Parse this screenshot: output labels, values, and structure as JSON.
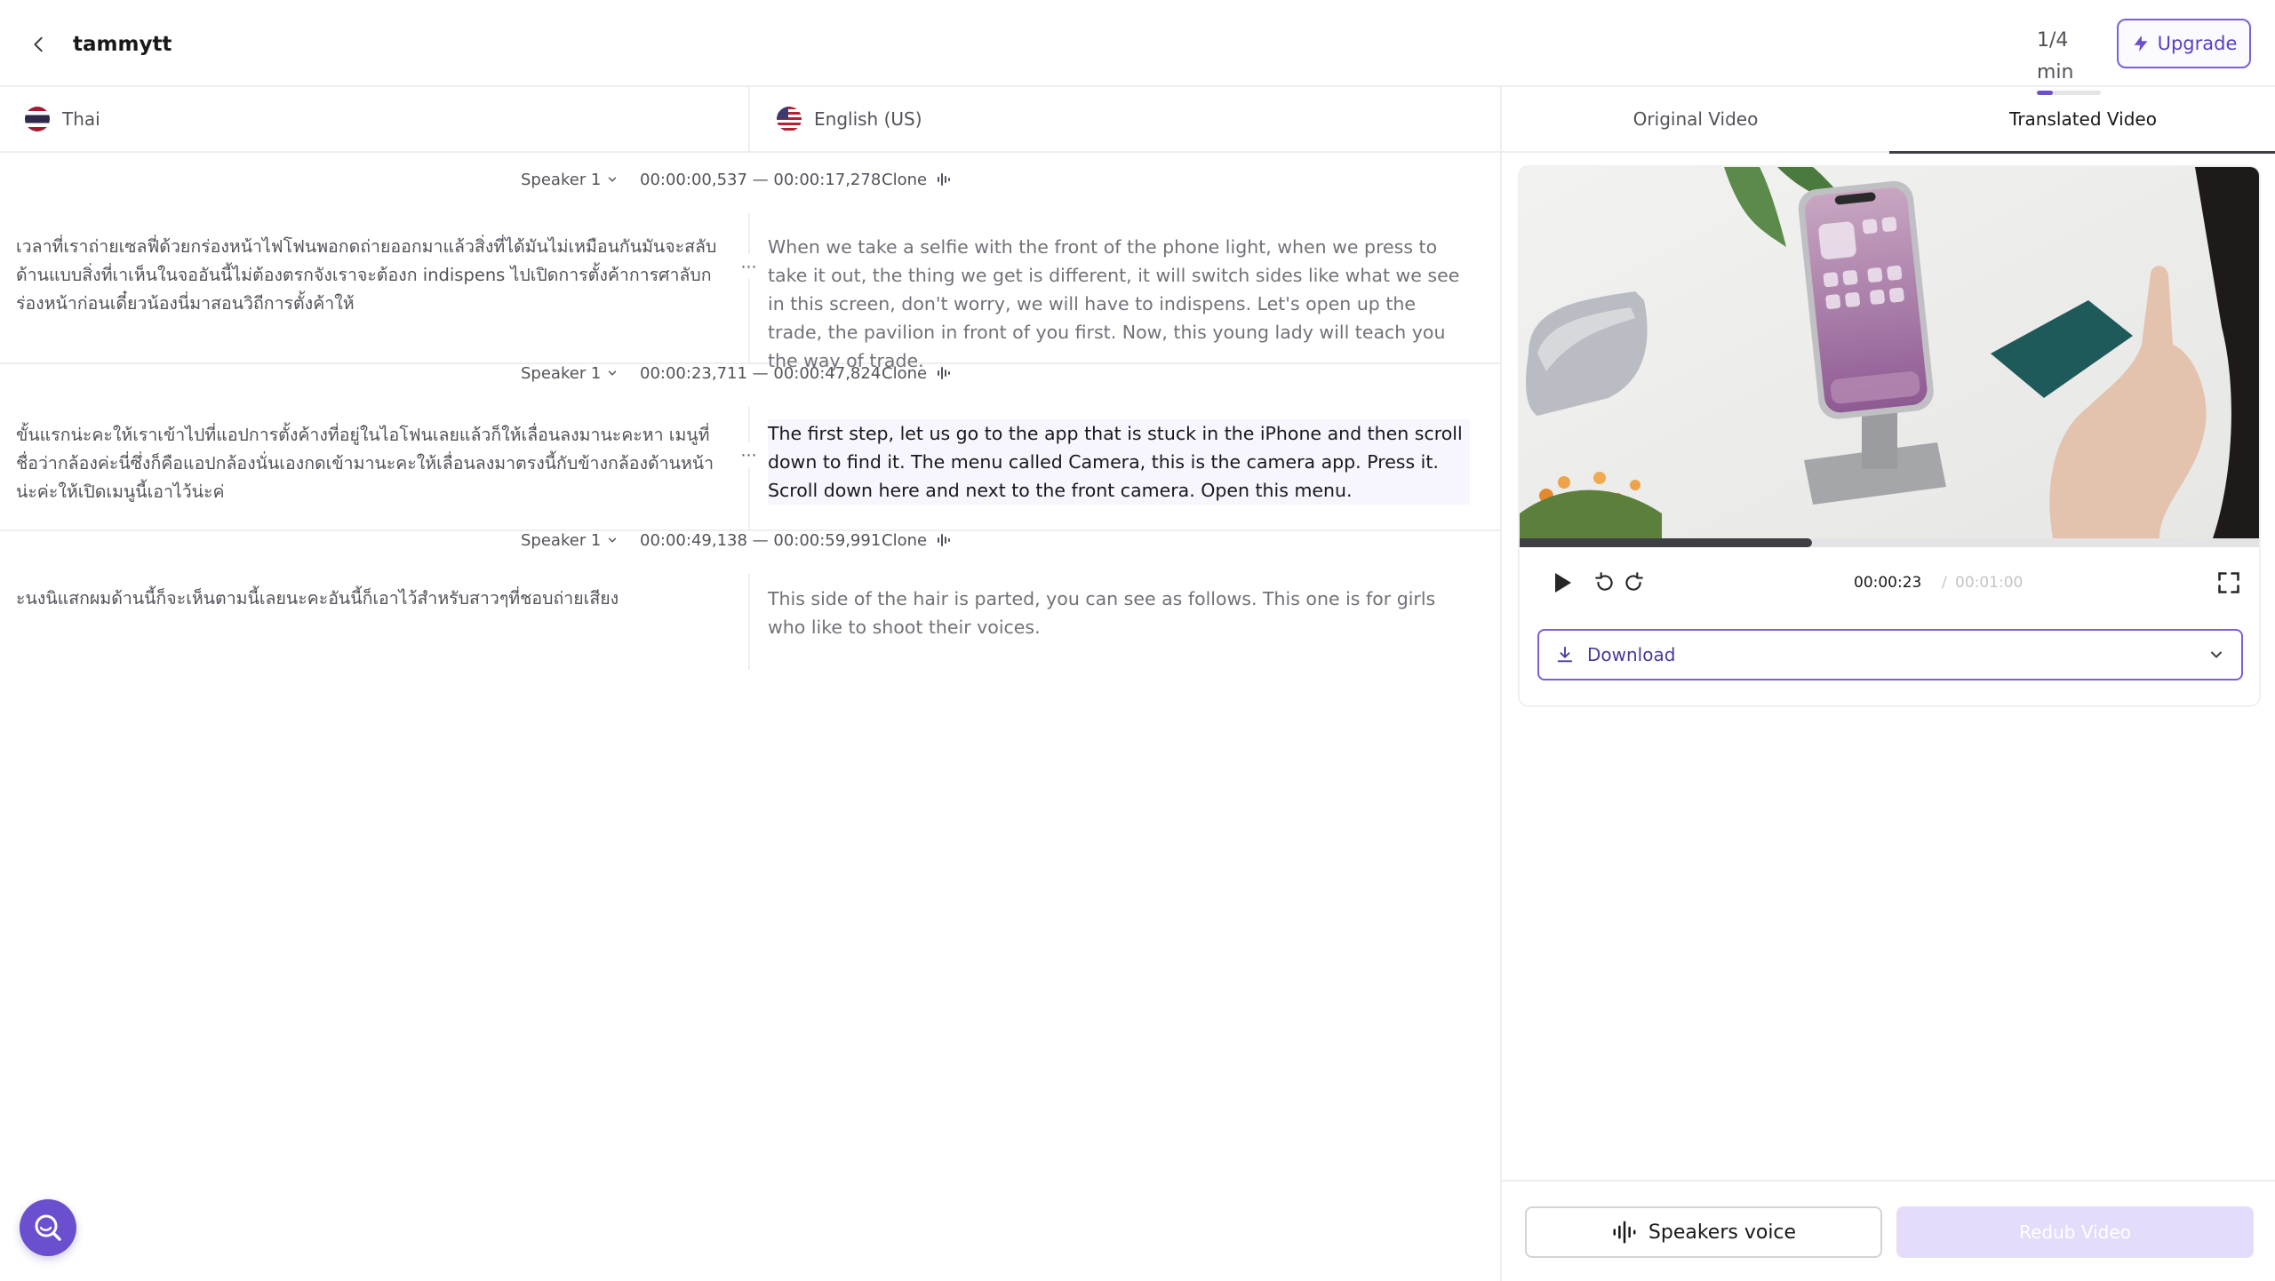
{
  "header": {
    "project_title": "tammytt",
    "usage_text": "1/4 min",
    "usage_fraction": 0.25,
    "upgrade_label": "Upgrade"
  },
  "languages": {
    "source": {
      "label": "Thai",
      "flag": "thailand-flag"
    },
    "target": {
      "label": "English (US)",
      "flag": "us-flag"
    }
  },
  "segments": [
    {
      "speaker": "Speaker 1",
      "time_range": "00:00:00,537 — 00:00:17,278",
      "clone_label": "Clone",
      "source_text": "เวลาที่เราถ่ายเซลฟี่ด้วยกร่องหน้าไฟโฟนพอกดถ่ายออกมาแล้วสิ่งที่ได้มันไม่เหมือนกันมันจะสลับด้านแบบสิ่งที่เาเห็นในจออันนี้ไม่ต้องตรกจังเราจะต้องก indispens ไปเปิดการตั้งค้าการศาลับกร่องหน้าก่อนเดี๋ยวน้องนี่มาสอนวิถีการตั้งค้าให้",
      "target_text": "When we take a selfie with the front of the phone light, when we press to take it out, the thing we get is different, it will switch sides like what we see in this screen, don't worry, we will have to indispens. Let's open up the trade, the pavilion in front of you first. Now, this young lady will teach you the way of trade.",
      "active": false
    },
    {
      "speaker": "Speaker 1",
      "time_range": "00:00:23,711 — 00:00:47,824",
      "clone_label": "Clone",
      "source_text": "ขั้นแรกน่ะคะให้เราเข้าไปที่แอปการตั้งค้างที่อยู่ในไอโฟนเลยแล้วก็ให้เลื่อนลงมานะคะหา เมนูที่ชื่อว่ากล้องค่ะนี่ซึ่งก็คือแอปกล้องนั่นเองกดเข้ามานะคะให้เลื่อนลงมาตรงนี้กับข้างกล้องด้านหน้าน่ะค่ะให้เปิดเมนูนี้เอาไว้น่ะค่",
      "target_text": "The first step, let us go to the app that is stuck in the iPhone and then scroll down to find it. The menu called Camera, this is the camera app. Press it. Scroll down here and next to the front camera. Open this menu.",
      "active": true
    },
    {
      "speaker": "Speaker 1",
      "time_range": "00:00:49,138 — 00:00:59,991",
      "clone_label": "Clone",
      "source_text": "ะนงนิแสกผมด้านนี้ก็จะเห็นตามนี้เลยนะคะอันนี้ก็เอาไว้สำหรับสาวๆที่ชอบถ่ายเสียง",
      "target_text": "This side of the hair is parted, you can see as follows. This one is for girls who like to shoot their voices.",
      "active": false
    }
  ],
  "right_panel": {
    "tabs": [
      {
        "label": "Original Video",
        "active": false
      },
      {
        "label": "Translated Video",
        "active": true
      }
    ],
    "player": {
      "current_time": "00:00:23",
      "separator": "/",
      "total_time": "00:01:00",
      "progress_fraction": 0.395
    },
    "download_label": "Download",
    "speakers_voice_label": "Speakers voice",
    "redub_label": "Redub Video"
  },
  "colors": {
    "accent": "#6d4fc7",
    "redub_disabled": "#e5dbfb",
    "active_row_bg": "#f7f5fd"
  }
}
